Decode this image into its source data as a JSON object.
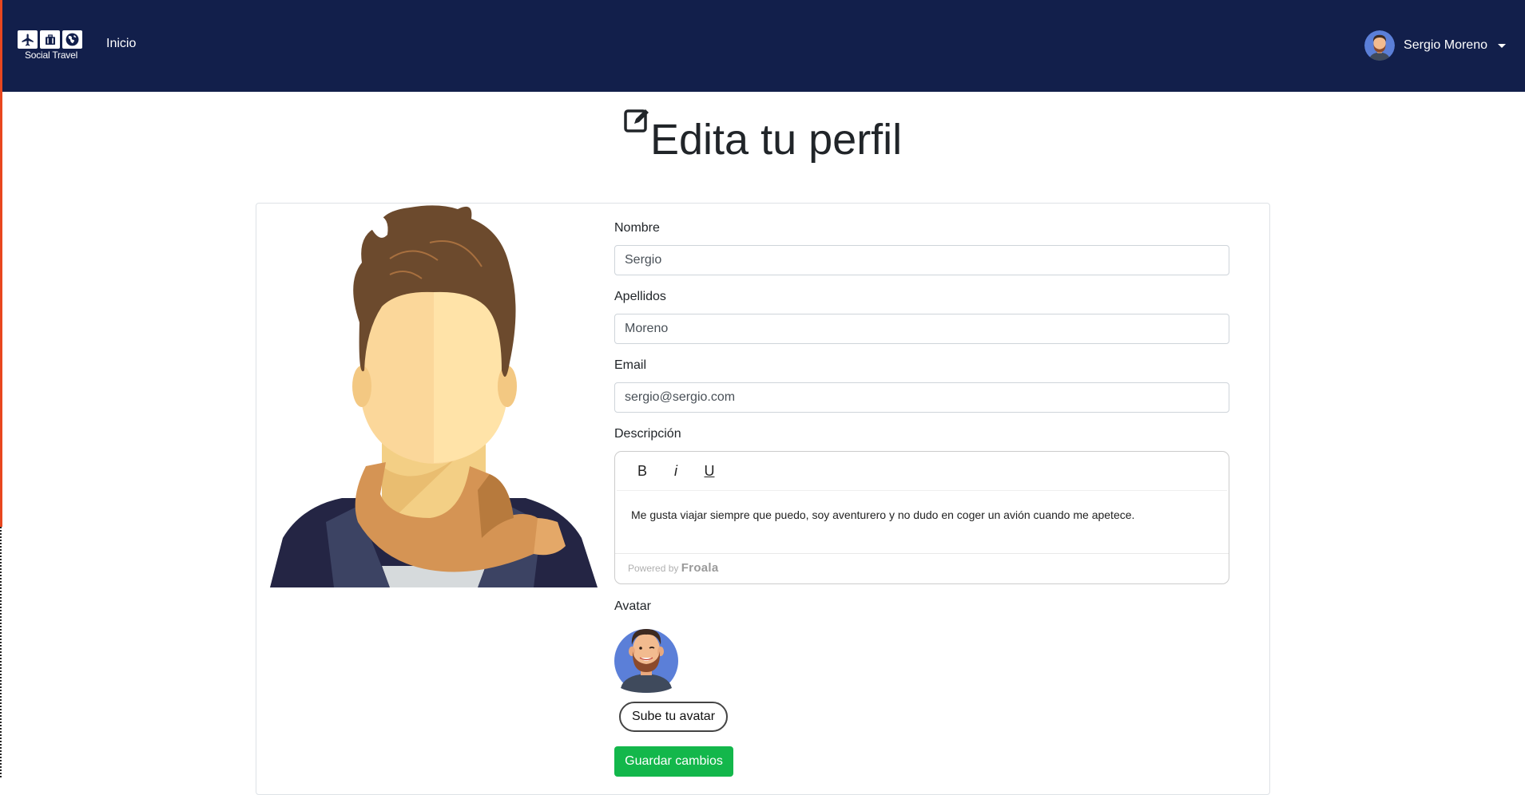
{
  "brand": {
    "name": "Social Travel"
  },
  "nav": {
    "home_label": "Inicio",
    "user_name": "Sergio Moreno"
  },
  "page": {
    "title": "Edita tu perfil"
  },
  "form": {
    "nombre_label": "Nombre",
    "nombre_value": "Sergio",
    "apellidos_label": "Apellidos",
    "apellidos_value": "Moreno",
    "email_label": "Email",
    "email_value": "sergio@sergio.com",
    "descripcion_label": "Descripción",
    "descripcion_value": "Me gusta viajar siempre que puedo, soy aventurero y no dudo en coger un avión cuando me apetece.",
    "avatar_label": "Avatar",
    "upload_label": "Sube tu avatar",
    "save_label": "Guardar cambios"
  },
  "editor": {
    "bold_label": "B",
    "italic_label": "i",
    "underline_label": "U",
    "powered_by": "Powered by",
    "vendor": "Froala"
  },
  "colors": {
    "navbar": "#121f4b",
    "save_button": "#13b74b",
    "accent_strip": "#e8471f"
  },
  "icons": [
    "airplane-icon",
    "luggage-icon",
    "globe-icon",
    "edit-square-icon",
    "caret-down-icon"
  ]
}
